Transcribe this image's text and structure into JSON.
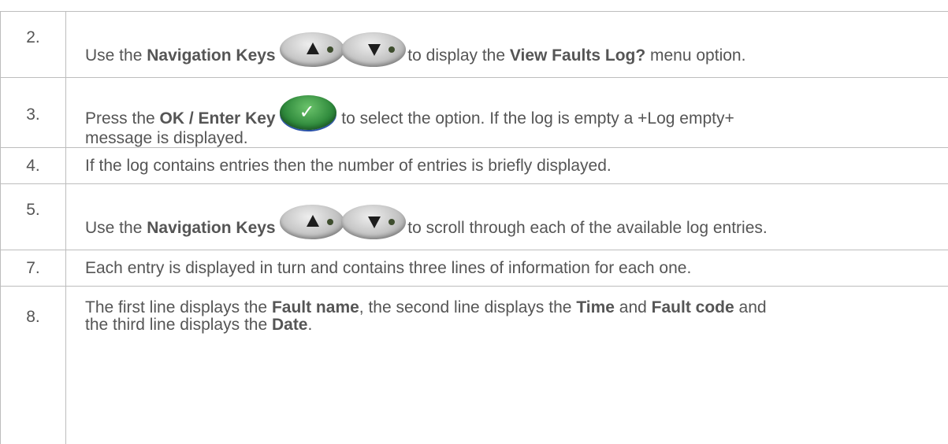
{
  "steps": [
    {
      "number": "2.",
      "parts": {
        "a": "Use the ",
        "b": "Navigation Keys",
        "c": " to display the ",
        "d": "View Faults Log?",
        "e": " menu option."
      },
      "icons": [
        "up-arrow-key-icon",
        "down-arrow-key-icon"
      ]
    },
    {
      "number": "3.",
      "parts": {
        "a": "Press the ",
        "b": "OK / Enter Key",
        "c": " to select the option. If the log is empty a +Log empty+",
        "d": "message is displayed."
      },
      "icons": [
        "ok-enter-key-icon"
      ]
    },
    {
      "number": "4.",
      "text": "If the log contains entries then the number of entries is briefly displayed."
    },
    {
      "number": "5.",
      "parts": {
        "a": "Use the ",
        "b": "Navigation Keys",
        "c": " to scroll through each of the available log entries."
      },
      "icons": [
        "up-arrow-key-icon",
        "down-arrow-key-icon"
      ]
    },
    {
      "number": "7.",
      "text": "Each entry is displayed in turn and contains three lines of information for each one."
    },
    {
      "number": "8.",
      "parts": {
        "a": "The first line displays the ",
        "b": "Fault name",
        "c": ", the second line displays the ",
        "d": "Time",
        "e": " and ",
        "f": "Fault code",
        "g": " and",
        "h": "the third line displays the ",
        "i": "Date",
        "j": "."
      }
    }
  ],
  "colors": {
    "text": "#555555",
    "border": "#bdbdbd",
    "ok_key_green": "#2f8a3c",
    "nav_key_grey": "#c4c4c4"
  },
  "check_glyph": "✓"
}
